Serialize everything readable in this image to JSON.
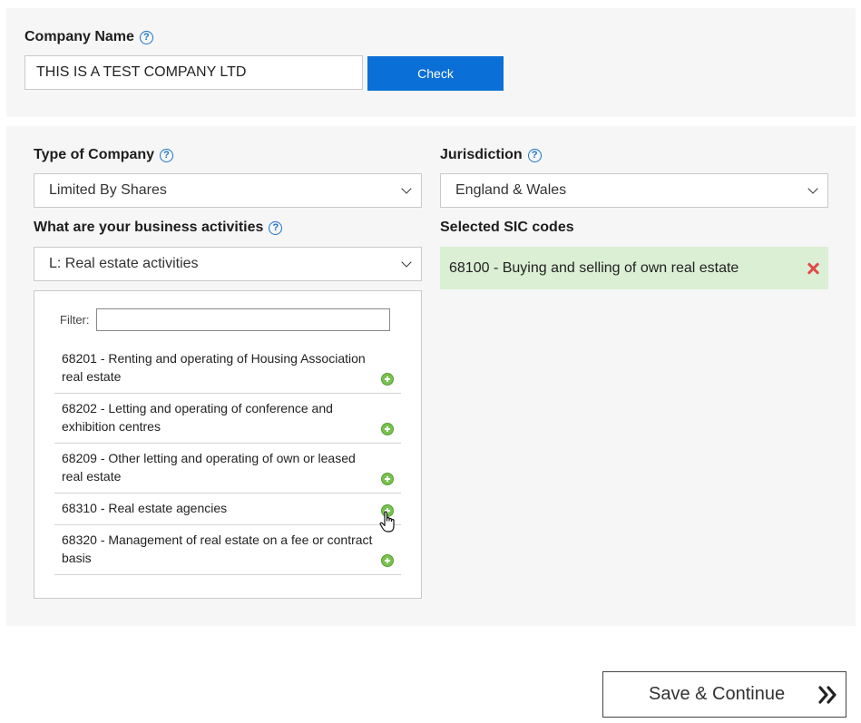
{
  "company": {
    "label": "Company Name",
    "help": "?",
    "value": "THIS IS A TEST COMPANY LTD",
    "check_label": "Check"
  },
  "type_of_company": {
    "label": "Type of Company",
    "help": "?",
    "selected": "Limited By Shares"
  },
  "jurisdiction": {
    "label": "Jurisdiction",
    "help": "?",
    "selected": "England & Wales"
  },
  "business_activities": {
    "label": "What are your business activities",
    "help": "?",
    "selected": "L: Real estate activities"
  },
  "sic_list": {
    "filter_label": "Filter:",
    "filter_value": "",
    "items": [
      {
        "text": "68201 - Renting and operating of Housing Association real estate"
      },
      {
        "text": "68202 - Letting and operating of conference and exhibition centres"
      },
      {
        "text": "68209 - Other letting and operating of own or leased real estate"
      },
      {
        "text": "68310 - Real estate agencies"
      },
      {
        "text": "68320 - Management of real estate on a fee or contract basis"
      }
    ]
  },
  "selected_sic": {
    "label": "Selected SIC codes",
    "items": [
      {
        "text": "68100 - Buying and selling of own real estate"
      }
    ]
  },
  "footer": {
    "save_label": "Save & Continue"
  },
  "icons": {
    "help": "question-circle-icon",
    "add": "plus-circle-icon",
    "remove": "red-x-icon",
    "next": "double-chevron-right-icon",
    "cursor": "hand-pointer-icon"
  },
  "colors": {
    "primary": "#0a6fd6",
    "help_icon": "#1a73c8",
    "selected_bg": "#dbefd4",
    "add_icon": "#78c24f",
    "remove_icon": "#e04a4a"
  }
}
